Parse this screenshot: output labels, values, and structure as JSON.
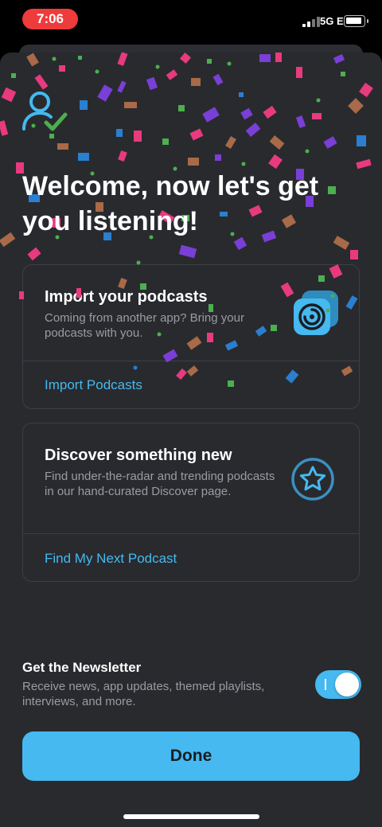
{
  "status_bar": {
    "time": "7:06",
    "network": "5G E",
    "icons": [
      "signal-bars-icon",
      "battery-icon"
    ]
  },
  "welcome": {
    "icon": "user-check-icon",
    "title": "Welcome, now let's get you listening!"
  },
  "import_card": {
    "title": "Import your podcasts",
    "description": "Coming from another app? Bring your podcasts with you.",
    "icon": "podcast-import-icon",
    "link_label": "Import Podcasts"
  },
  "discover_card": {
    "title": "Discover something new",
    "description": "Find under-the-radar and trending podcasts in our hand-curated Discover page.",
    "icon": "star-icon",
    "link_label": "Find My Next Podcast"
  },
  "newsletter": {
    "title": "Get the Newsletter",
    "description": "Receive news, app updates, themed playlists, interviews, and more.",
    "enabled": true
  },
  "done_label": "Done",
  "colors": {
    "accent": "#45b9f0",
    "background": "#292a2e",
    "time_pill": "#ee3b3b",
    "check": "#4caf50"
  }
}
